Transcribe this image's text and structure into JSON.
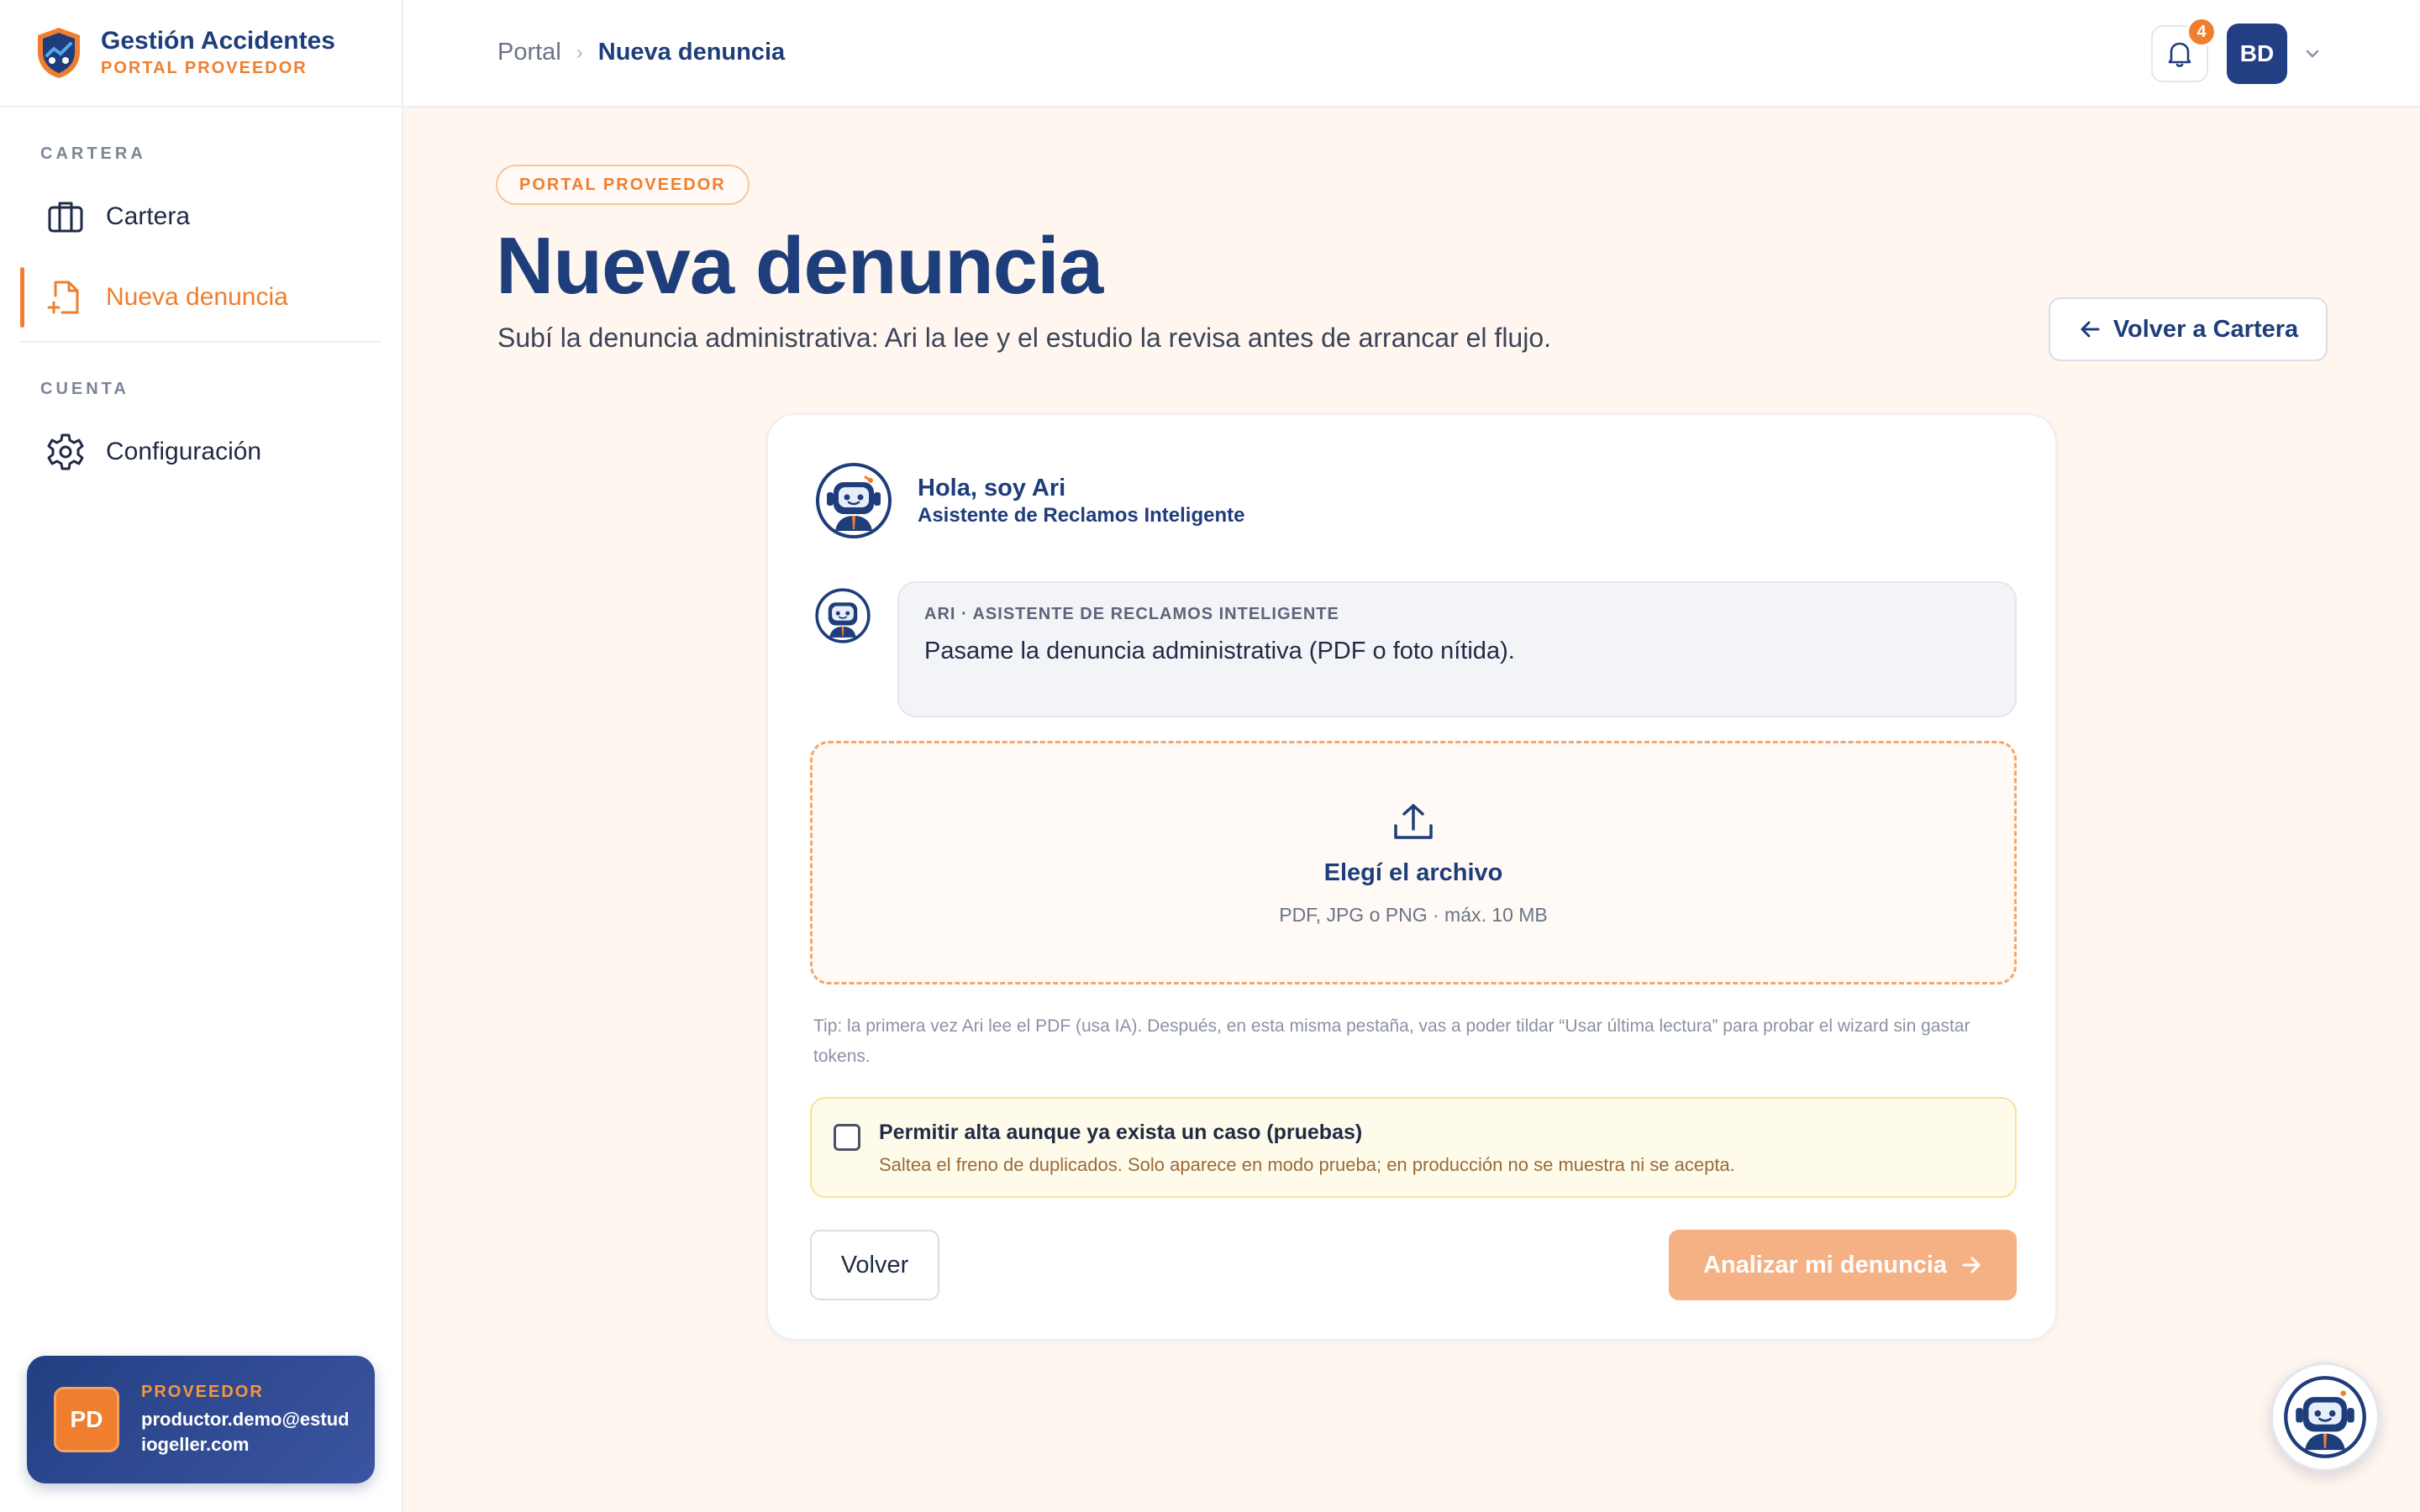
{
  "brand": {
    "title": "Gestión Accidentes",
    "subtitle": "PORTAL PROVEEDOR"
  },
  "sidebar": {
    "sections": [
      {
        "label": "CARTERA"
      },
      {
        "label": "CUENTA"
      }
    ],
    "items": [
      {
        "label": "Cartera",
        "icon": "briefcase-icon"
      },
      {
        "label": "Nueva denuncia",
        "icon": "file-plus-icon",
        "active": true
      },
      {
        "label": "Configuración",
        "icon": "gear-icon"
      }
    ]
  },
  "user": {
    "initials": "PD",
    "role": "PROVEEDOR",
    "email": "productor.demo@estudiogeller.com"
  },
  "topbar": {
    "breadcrumb": [
      "Portal",
      "Nueva denuncia"
    ],
    "notifications_count": "4",
    "avatar_initials": "BD"
  },
  "page": {
    "pill": "PORTAL PROVEEDOR",
    "title": "Nueva denuncia",
    "subtitle": "Subí la denuncia administrativa: Ari la lee y el estudio la revisa antes de arrancar el flujo.",
    "back_button": "Volver a Cartera"
  },
  "card": {
    "assistant_name": "Hola, soy Ari",
    "assistant_role": "Asistente de Reclamos Inteligente",
    "message_label": "ARI · ASISTENTE DE RECLAMOS INTELIGENTE",
    "message_text": "Pasame la denuncia administrativa (PDF o foto nítida).",
    "dropzone_title": "Elegí el archivo",
    "dropzone_sub": "PDF, JPG o PNG · máx. 10 MB",
    "tip": "Tip: la primera vez Ari lee el PDF (usa IA). Después, en esta misma pestaña, vas a poder tildar “Usar última lectura” para probar el wizard sin gastar tokens.",
    "checkbox_title": "Permitir alta aunque ya exista un caso (pruebas)",
    "checkbox_sub": "Saltea el freno de duplicados. Solo aparece en modo prueba; en producción no se muestra ni se acepta.",
    "checkbox_checked": false,
    "btn_back": "Volver",
    "btn_submit": "Analizar mi denuncia"
  },
  "colors": {
    "primary": "#1e3d7b",
    "accent": "#ef7e2e",
    "background": "#fff7ef"
  }
}
